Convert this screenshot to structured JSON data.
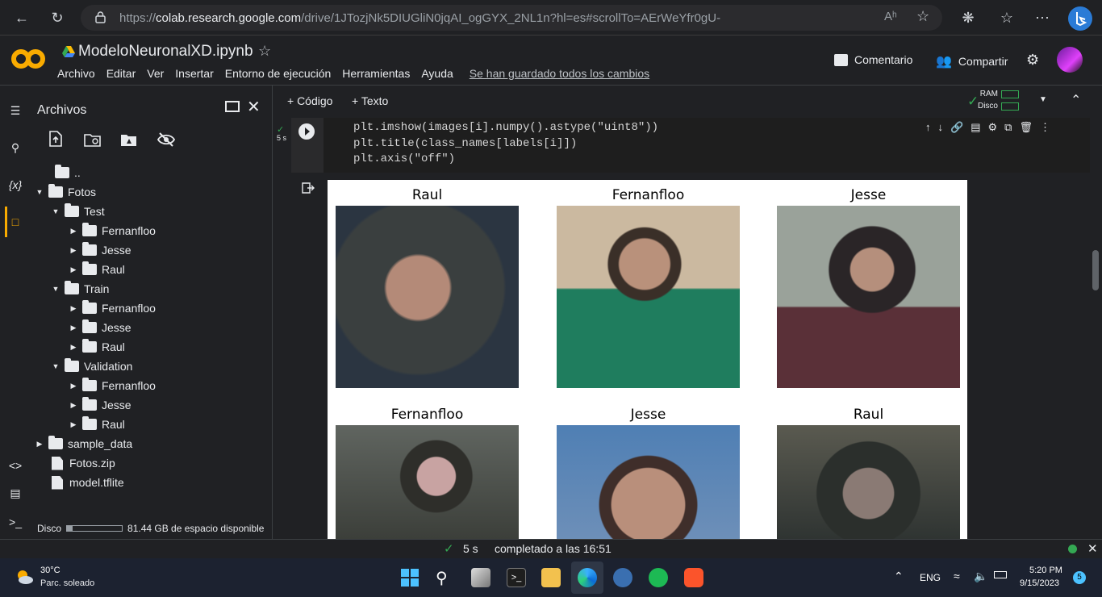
{
  "browser": {
    "url_prefix": "https://",
    "url_domain": "colab.research.google.com",
    "url_path": "/drive/1JTozjNk5DIUGliN0jqAI_ogGYX_2NL1n?hl=es#scrollTo=AErWeYfr0gU-",
    "reader_label": "Aʰ"
  },
  "header": {
    "title": "ModeloNeuronalXD.ipynb",
    "menu": [
      "Archivo",
      "Editar",
      "Ver",
      "Insertar",
      "Entorno de ejecución",
      "Herramientas",
      "Ayuda"
    ],
    "saved_status": "Se han guardado todos los cambios",
    "comment_label": "Comentario",
    "share_label": "Compartir"
  },
  "files": {
    "title": "Archivos",
    "tree": [
      {
        "label": "..",
        "type": "up"
      },
      {
        "label": "Fotos",
        "type": "folder",
        "open": true
      },
      {
        "label": "Test",
        "type": "folder",
        "open": true
      },
      {
        "label": "Fernanfloo",
        "type": "folder"
      },
      {
        "label": "Jesse",
        "type": "folder"
      },
      {
        "label": "Raul",
        "type": "folder"
      },
      {
        "label": "Train",
        "type": "folder",
        "open": true
      },
      {
        "label": "Fernanfloo",
        "type": "folder"
      },
      {
        "label": "Jesse",
        "type": "folder"
      },
      {
        "label": "Raul",
        "type": "folder"
      },
      {
        "label": "Validation",
        "type": "folder",
        "open": true
      },
      {
        "label": "Fernanfloo",
        "type": "folder"
      },
      {
        "label": "Jesse",
        "type": "folder"
      },
      {
        "label": "Raul",
        "type": "folder"
      },
      {
        "label": "sample_data",
        "type": "folder"
      },
      {
        "label": "Fotos.zip",
        "type": "file"
      },
      {
        "label": "model.tflite",
        "type": "file"
      }
    ],
    "disk_label": "Disco",
    "disk_free": "81.44 GB de espacio disponible",
    "disk_used_fraction": 0.1
  },
  "toolbar": {
    "code_label": "+ Código",
    "text_label": "+ Texto",
    "ram_label": "RAM",
    "disk_label": "Disco"
  },
  "cell": {
    "exec_time": "5 s",
    "code_lines": [
      "plt.imshow(images[i].numpy().astype(\"uint8\"))",
      "plt.title(class_names[labels[i]])",
      "plt.axis(\"off\")"
    ]
  },
  "output": {
    "titles": [
      "Raul",
      "Fernanfloo",
      "Jesse",
      "Fernanfloo",
      "Jesse",
      "Raul"
    ]
  },
  "status": {
    "time": "5 s",
    "completed": "completado a las 16:51"
  },
  "taskbar": {
    "weather_temp": "30°C",
    "weather_desc": "Parc. soleado",
    "lang": "ENG",
    "time": "5:20 PM",
    "date": "9/15/2023",
    "notif_count": "5"
  },
  "colors": {
    "accent_orange": "#f9ab00",
    "check_green": "#34a853",
    "panel_bg": "#202124"
  }
}
